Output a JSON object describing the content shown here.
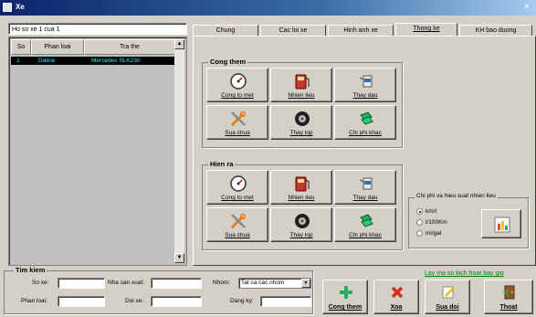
{
  "window": {
    "title": "Xe",
    "close_glyph": "×"
  },
  "record_title": "Ho so xe 1 cua 1",
  "grid": {
    "columns": [
      "So",
      "Phan loai",
      "Tra the"
    ],
    "rows": [
      {
        "no": "1",
        "type": "Daline",
        "plate": "Mercedes SLK230"
      }
    ]
  },
  "tabs": [
    "Chung",
    "Cac loi xe",
    "Hinh anh xe",
    "Thong ke",
    "KH bao duong"
  ],
  "active_tab": "Thong ke",
  "income": {
    "legend": "Cong them",
    "buttons": [
      {
        "label": "Cong to met",
        "icon": "speedometer-icon"
      },
      {
        "label": "Nhien lieu",
        "icon": "fuel-icon"
      },
      {
        "label": "Thay dau",
        "icon": "oil-can-icon"
      },
      {
        "label": "Sua chua",
        "icon": "tools-icon"
      },
      {
        "label": "Thay lop",
        "icon": "tire-icon"
      },
      {
        "label": "Chi phi khac",
        "icon": "money-icon"
      }
    ]
  },
  "expense": {
    "legend": "Hien ra",
    "buttons": [
      {
        "label": "Cong to met",
        "icon": "speedometer-icon"
      },
      {
        "label": "Nhien lieu",
        "icon": "fuel-icon"
      },
      {
        "label": "Thay dau",
        "icon": "oil-can-icon"
      },
      {
        "label": "Sua chua",
        "icon": "tools-icon"
      },
      {
        "label": "Thay lop",
        "icon": "tire-icon"
      },
      {
        "label": "Chi phi khac",
        "icon": "money-icon"
      }
    ]
  },
  "efficiency": {
    "legend": "Chi phi va hieu suat nhien lieu",
    "options": [
      "km/l",
      "l/100Km",
      "mi/gal"
    ],
    "selected": "km/l",
    "chart_icon": "bar-chart-icon"
  },
  "search": {
    "legend": "Tim kiem",
    "plate_label": "So xe:",
    "manufacturer_label": "Nha san xuat:",
    "group_label": "Nhom:",
    "group_value": "Tat ca cac nhom",
    "type_label": "Phan loai:",
    "model_label": "Doi xe:",
    "registration_label": "Dang ky:"
  },
  "activation_link": "Lay ma so kich hoat bay gio",
  "actions": [
    {
      "label": "Cong them",
      "icon": "plus-icon"
    },
    {
      "label": "Xoa",
      "icon": "delete-icon"
    },
    {
      "label": "Sua doi",
      "icon": "edit-icon"
    },
    {
      "label": "Thoat",
      "icon": "exit-door-icon"
    }
  ],
  "colors": {
    "selected_row_bg": "#000000",
    "selected_row_text": "#00ffff",
    "link": "#008000",
    "titlebar": "#0a246a"
  }
}
